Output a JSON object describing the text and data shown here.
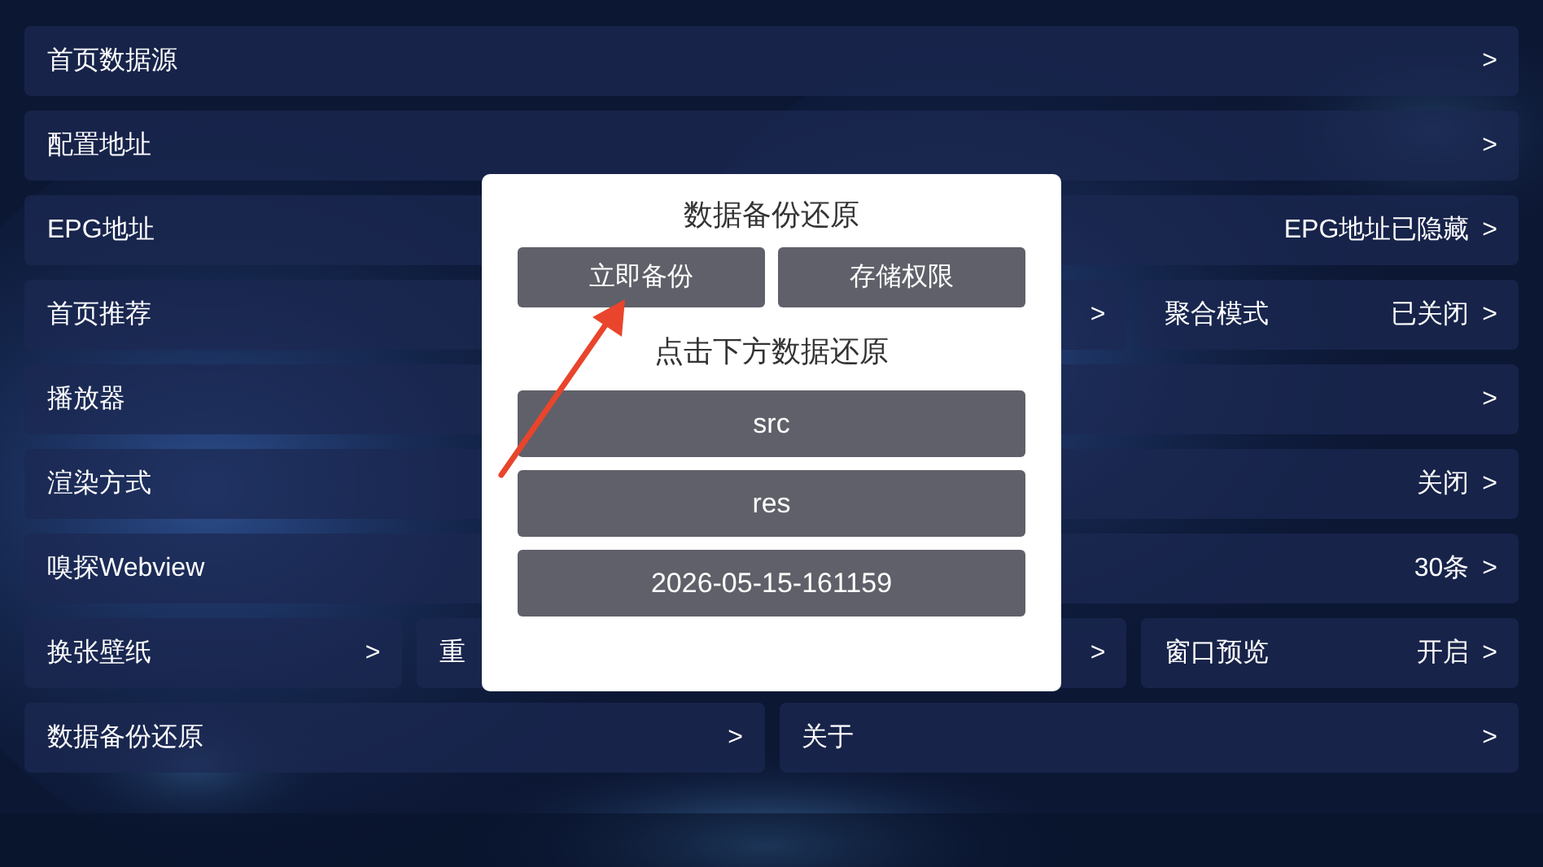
{
  "settings": [
    [
      {
        "label": "首页数据源",
        "chevron": ">",
        "kind": "wide"
      }
    ],
    [
      {
        "label": "配置地址",
        "chevron": ">",
        "kind": "wide"
      }
    ],
    [
      {
        "label": "EPG地址",
        "value": "EPG地址已隐藏",
        "chevron": ">",
        "kind": "wide"
      }
    ],
    [
      {
        "label": "首页推荐",
        "kind": "wide"
      },
      {
        "chevron": ">",
        "kind": "narrow"
      },
      {
        "label": "聚合模式",
        "value": "已关闭",
        "chevron": ">",
        "kind": "narrow"
      }
    ],
    [
      {
        "label": "播放器",
        "chevron": ">",
        "kind": "wide"
      }
    ],
    [
      {
        "label": "渲染方式",
        "value": "关闭",
        "chevron": ">",
        "kind": "wide"
      }
    ],
    [
      {
        "label": "嗅探Webview",
        "value": "30条",
        "chevron": ">",
        "kind": "wide"
      }
    ],
    [
      {
        "label": "换张壁纸",
        "chevron": ">",
        "kind": "narrow"
      },
      {
        "label": "重",
        "chevron": ">",
        "kind": "wide"
      },
      {
        "label": "窗口预览",
        "value": "开启",
        "chevron": ">",
        "kind": "narrow"
      }
    ],
    [
      {
        "label": "数据备份还原",
        "chevron": ">",
        "kind": "wide"
      },
      {
        "label": "关于",
        "chevron": ">",
        "kind": "wide"
      }
    ]
  ],
  "dialog": {
    "title": "数据备份还原",
    "actions": [
      "立即备份",
      "存储权限"
    ],
    "subtitle": "点击下方数据还原",
    "restore_items": [
      "src",
      "res",
      "2026-05-15-161159"
    ]
  }
}
